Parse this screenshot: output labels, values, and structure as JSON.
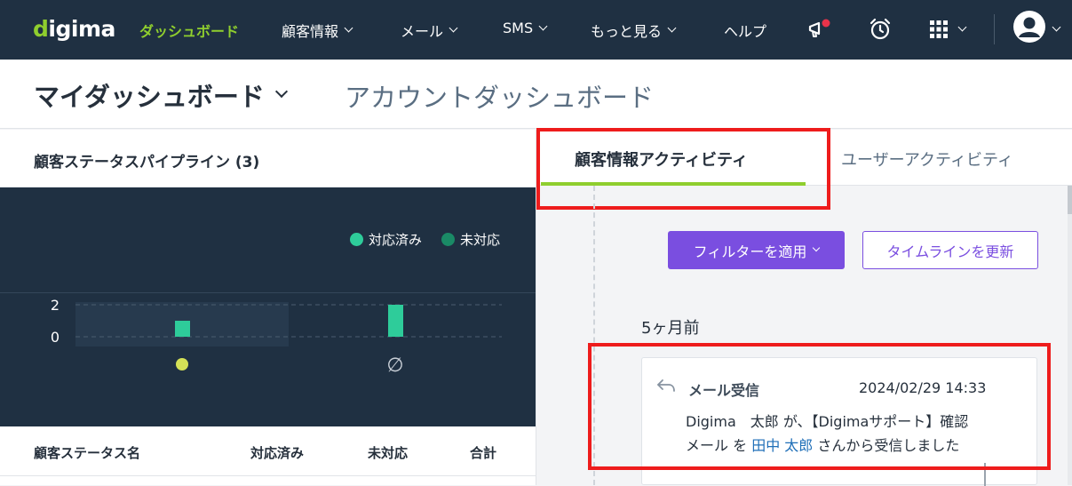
{
  "nav": {
    "logo": "digima",
    "logo_accent": "d",
    "logo_rest": "igima",
    "items": [
      {
        "label": "ダッシュボード",
        "active": true
      },
      {
        "label": "顧客情報"
      },
      {
        "label": "メール"
      },
      {
        "label": "SMS"
      },
      {
        "label": "もっと見る"
      },
      {
        "label": "ヘルプ"
      }
    ],
    "icons": [
      "announcement-icon",
      "alarm-clock-icon",
      "apps-grid-icon",
      "user-avatar-icon"
    ]
  },
  "header": {
    "my_dashboard": "マイダッシュボード",
    "account_dashboard": "アカウントダッシュボード"
  },
  "pipeline": {
    "title": "顧客ステータスパイプライン (3)",
    "legend": [
      {
        "label": "対応済み",
        "color": "#2ecc9a"
      },
      {
        "label": "未対応",
        "color": "#1a8a66"
      }
    ],
    "table_headers": [
      "顧客ステータス名",
      "対応済み",
      "未対応",
      "合計"
    ]
  },
  "chart_data": {
    "type": "bar",
    "categories": [
      "●",
      "∅"
    ],
    "category_colors": [
      "#d4e157",
      "#c8ced6"
    ],
    "series": [
      {
        "name": "対応済み",
        "values": [
          1,
          2
        ],
        "color": "#2ecc9a"
      }
    ],
    "yticks": [
      "2",
      "0"
    ],
    "ylim": [
      0,
      2
    ]
  },
  "activity": {
    "tabs": [
      {
        "label": "顧客情報アクティビティ",
        "active": true
      },
      {
        "label": "ユーザーアクティビティ"
      }
    ],
    "filter_button": "フィルターを適用",
    "refresh_button": "タイムラインを更新",
    "time_ago": "5ヶ月前",
    "card": {
      "type": "メール受信",
      "date": "2024/02/29 14:33",
      "line1": "Digima　太郎 が、【Digimaサポート】確認",
      "line2_pre": "メール を ",
      "line2_link": "田中 太郎",
      "line2_post": " さんから受信しました"
    }
  },
  "colors": {
    "nav_bg": "#1f3042",
    "accent_green": "#8fce2e",
    "accent_purple": "#7a4ee0",
    "highlight_red": "#ee1c1c"
  }
}
